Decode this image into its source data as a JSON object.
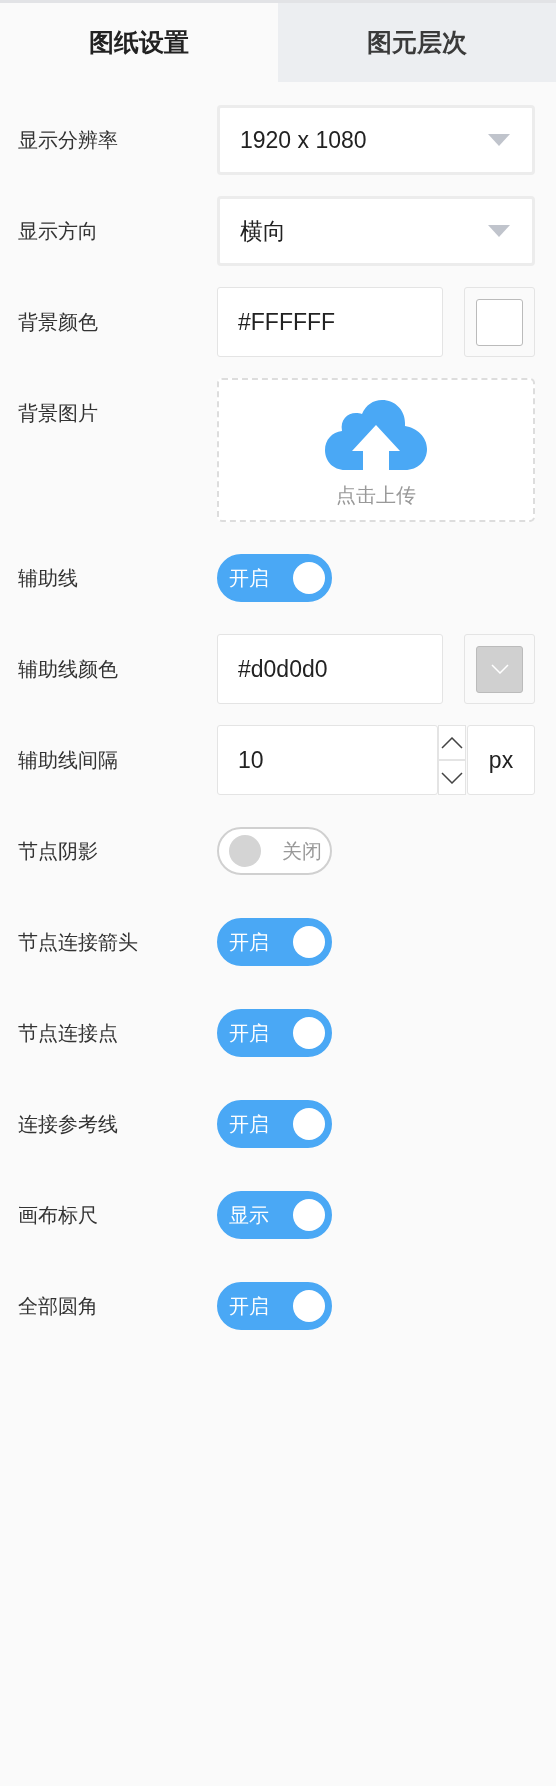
{
  "tabs": [
    {
      "label": "图纸设置",
      "selected": true
    },
    {
      "label": "图元层次",
      "selected": false
    }
  ],
  "settings": [
    {
      "kind": "select",
      "label": "显示分辨率",
      "value": "1920 x 1080"
    },
    {
      "kind": "select",
      "label": "显示方向",
      "value": "横向"
    },
    {
      "kind": "color",
      "label": "背景颜色",
      "value": "#FFFFFF",
      "color": "#ffffff"
    },
    {
      "kind": "upload",
      "label": "背景图片",
      "text": "点击上传"
    },
    {
      "kind": "toggle",
      "label": "辅助线",
      "on": true,
      "text": "开启"
    },
    {
      "kind": "color",
      "label": "辅助线颜色",
      "value": "#d0d0d0",
      "color": "#d0d0d0"
    },
    {
      "kind": "number",
      "label": "辅助线间隔",
      "value": "10",
      "unit": "px"
    },
    {
      "kind": "toggle",
      "label": "节点阴影",
      "on": false,
      "text": "关闭"
    },
    {
      "kind": "toggle",
      "label": "节点连接箭头",
      "on": true,
      "text": "开启"
    },
    {
      "kind": "toggle",
      "label": "节点连接点",
      "on": true,
      "text": "开启"
    },
    {
      "kind": "toggle",
      "label": "连接参考线",
      "on": true,
      "text": "开启"
    },
    {
      "kind": "toggle",
      "label": "画布标尺",
      "on": true,
      "text": "显示"
    },
    {
      "kind": "toggle",
      "label": "全部圆角",
      "on": true,
      "text": "开启"
    }
  ]
}
